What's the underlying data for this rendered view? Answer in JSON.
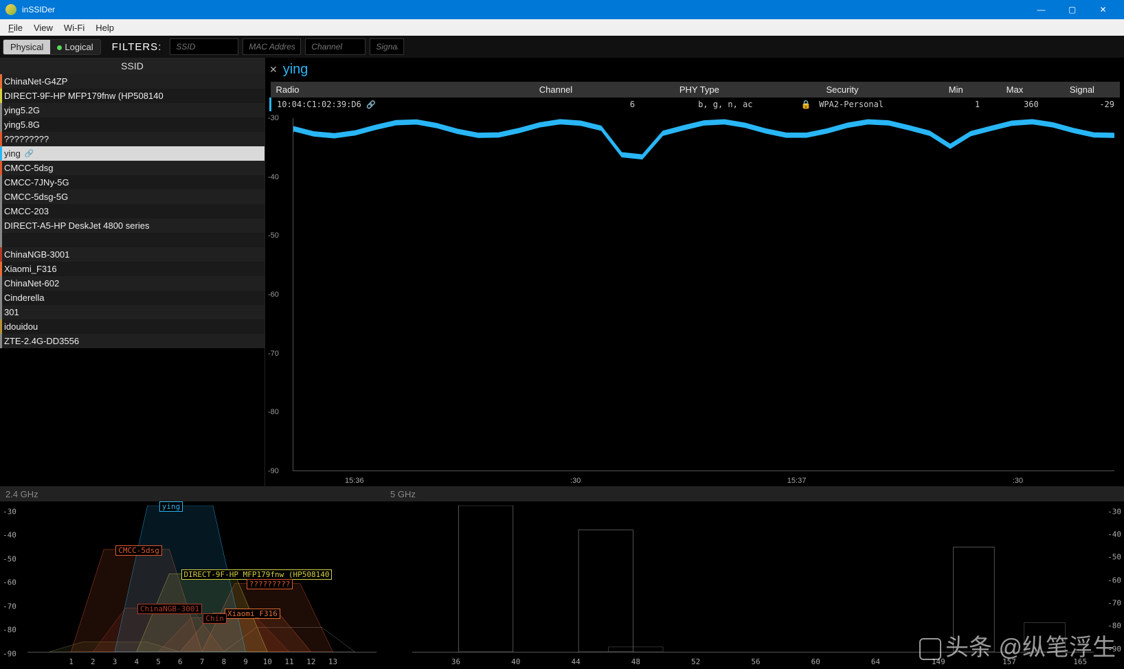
{
  "app": {
    "title": "inSSIDer"
  },
  "menu": {
    "file": "File",
    "view": "View",
    "wifi": "Wi-Fi",
    "help": "Help"
  },
  "filter": {
    "modes": {
      "physical": "Physical",
      "logical": "Logical"
    },
    "label": "FILTERS:",
    "placeholders": {
      "ssid": "SSID",
      "mac": "MAC Address",
      "channel": "Channel",
      "signal": "Signal"
    }
  },
  "ssid": {
    "header": "SSID",
    "selected": "ying",
    "items": [
      {
        "name": "ChinaNet-G4ZP",
        "color": "#e66f36"
      },
      {
        "name": "DIRECT-9F-HP MFP179fnw (HP508140",
        "color": "#d4d040"
      },
      {
        "name": "ying5.2G",
        "color": "#888"
      },
      {
        "name": "ying5.8G",
        "color": "#888"
      },
      {
        "name": "?????????",
        "color": "#e05a2d"
      },
      {
        "name": "ying",
        "color": "#29b6f6",
        "link": true
      },
      {
        "name": "CMCC-5dsg",
        "color": "#e05a2d"
      },
      {
        "name": "CMCC-7JNy-5G",
        "color": "#888"
      },
      {
        "name": "CMCC-5dsg-5G",
        "color": "#888"
      },
      {
        "name": "CMCC-203",
        "color": "#888"
      },
      {
        "name": "DIRECT-A5-HP DeskJet 4800 series",
        "color": "#888"
      },
      {
        "name": "",
        "color": "#888"
      },
      {
        "name": "ChinaNGB-3001",
        "color": "#b33b27"
      },
      {
        "name": "Xiaomi_F316",
        "color": "#e66f36"
      },
      {
        "name": "ChinaNet-602",
        "color": "#888"
      },
      {
        "name": "Cinderella",
        "color": "#888"
      },
      {
        "name": "301",
        "color": "#888"
      },
      {
        "name": "idouidou",
        "color": "#b8923a"
      },
      {
        "name": "ZTE-2.4G-DD3556",
        "color": "#888"
      }
    ]
  },
  "detail": {
    "title": "ying",
    "columns": {
      "radio": "Radio",
      "channel": "Channel",
      "phy": "PHY Type",
      "security": "Security",
      "min": "Min",
      "max": "Max",
      "signal": "Signal"
    },
    "row": {
      "radio": "10:04:C1:02:39:D6",
      "channel": "6",
      "phy": "b, g, n, ac",
      "security": "WPA2-Personal",
      "min": "1",
      "max": "360",
      "signal": "-29"
    }
  },
  "chart_data": {
    "signal_time": {
      "type": "line",
      "title": "",
      "ylabel": "",
      "xlabel": "",
      "ylim": [
        -90,
        -30
      ],
      "y_ticks": [
        -30,
        -40,
        -50,
        -60,
        -70,
        -80,
        -90
      ],
      "x_ticks": [
        "15:36",
        ":30",
        "15:37",
        ":30"
      ],
      "series": [
        {
          "name": "ying",
          "color": "#29b6f6",
          "approx_const": -30
        }
      ]
    },
    "spectrum_24": {
      "type": "area",
      "title": "2.4 GHz",
      "ylim": [
        -90,
        -30
      ],
      "y_ticks": [
        -30,
        -40,
        -50,
        -60,
        -70,
        -80,
        -90
      ],
      "x_ticks": [
        1,
        2,
        3,
        4,
        5,
        6,
        7,
        8,
        9,
        10,
        11,
        12,
        13
      ],
      "networks": [
        {
          "name": "ying",
          "center": 6,
          "width": 4,
          "signal": -30,
          "color": "#29b6f6"
        },
        {
          "name": "CMCC-5dsg",
          "center": 4,
          "width": 4,
          "signal": -48,
          "color": "#e05a2d"
        },
        {
          "name": "DIRECT-9F-HP MFP179fnw (HP508140",
          "center": 7,
          "width": 4,
          "signal": -58,
          "color": "#d4d040"
        },
        {
          "name": "?????????",
          "center": 10,
          "width": 4,
          "signal": -62,
          "color": "#e05a2d"
        },
        {
          "name": "ChinaNGB-3001",
          "center": 5,
          "width": 4,
          "signal": -72,
          "color": "#b33b27"
        },
        {
          "name": "Xiaomi_F316",
          "center": 9,
          "width": 4,
          "signal": -74,
          "color": "#e66f36"
        },
        {
          "name": "Chin",
          "center": 8,
          "width": 4,
          "signal": -76,
          "color": "#b33b27"
        },
        {
          "name": "",
          "center": 3,
          "width": 4,
          "signal": -86,
          "color": "#7a7a3a"
        },
        {
          "name": "",
          "center": 11,
          "width": 4,
          "signal": -80,
          "color": "#888"
        }
      ]
    },
    "spectrum_5": {
      "type": "bar",
      "title": "5 GHz",
      "ylim": [
        -90,
        -30
      ],
      "y_ticks": [
        -30,
        -40,
        -50,
        -60,
        -70,
        -80,
        -90
      ],
      "x_ticks": [
        36,
        40,
        44,
        48,
        52,
        56,
        60,
        64,
        149,
        157,
        165
      ],
      "networks": [
        {
          "channel": 38,
          "signal": -25,
          "color": "#ccc"
        },
        {
          "channel": 46,
          "signal": -40,
          "color": "#ccc"
        },
        {
          "channel": 48,
          "signal": -88,
          "color": "#777"
        },
        {
          "channel": 153,
          "signal": -47,
          "color": "#ccc"
        },
        {
          "channel": 161,
          "signal": -78,
          "color": "#888"
        }
      ]
    }
  },
  "watermark": "头条 @纵笔浮生"
}
